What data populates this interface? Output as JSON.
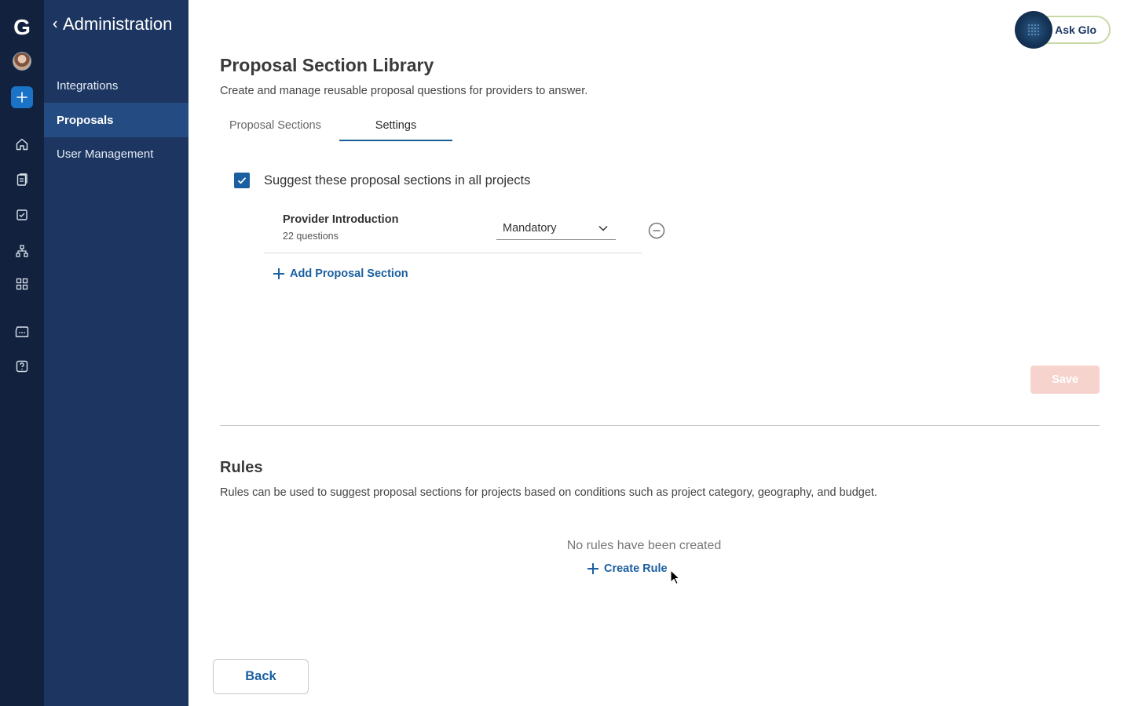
{
  "brand": {
    "logo_letter": "G"
  },
  "rail": {
    "items": [
      {
        "icon": "home-icon"
      },
      {
        "icon": "clipboard-icon"
      },
      {
        "icon": "checkbox-icon"
      },
      {
        "icon": "org-chart-icon"
      },
      {
        "icon": "grid-icon"
      },
      {
        "icon": "chat-icon"
      },
      {
        "icon": "help-icon"
      }
    ]
  },
  "sidebar": {
    "title": "Administration",
    "items": [
      {
        "label": "Integrations"
      },
      {
        "label": "Proposals"
      },
      {
        "label": "User Management"
      }
    ],
    "active_index": 1
  },
  "assistant": {
    "label": "Ask Glo"
  },
  "page": {
    "title": "Proposal Section Library",
    "subtitle": "Create and manage reusable proposal questions for providers to answer."
  },
  "tabs": [
    {
      "label": "Proposal Sections",
      "active": false
    },
    {
      "label": "Settings",
      "active": true
    }
  ],
  "settings": {
    "suggest_label": "Suggest these proposal sections in all projects",
    "suggest_checked": true,
    "sections": [
      {
        "name": "Provider Introduction",
        "count": "22 questions",
        "requirement": "Mandatory"
      }
    ],
    "add_section_label": "Add Proposal Section",
    "save_label": "Save"
  },
  "rules": {
    "title": "Rules",
    "description": "Rules can be used to suggest proposal sections for projects based on conditions such as project category, geography, and budget.",
    "empty_text": "No rules have been created",
    "create_label": "Create Rule"
  },
  "footer": {
    "back_label": "Back"
  },
  "colors": {
    "rail_bg": "#12213d",
    "sidebar_bg": "#1c3661",
    "sidebar_active": "#244b82",
    "accent": "#1b5fa0",
    "save_disabled": "#f6d4cd"
  }
}
